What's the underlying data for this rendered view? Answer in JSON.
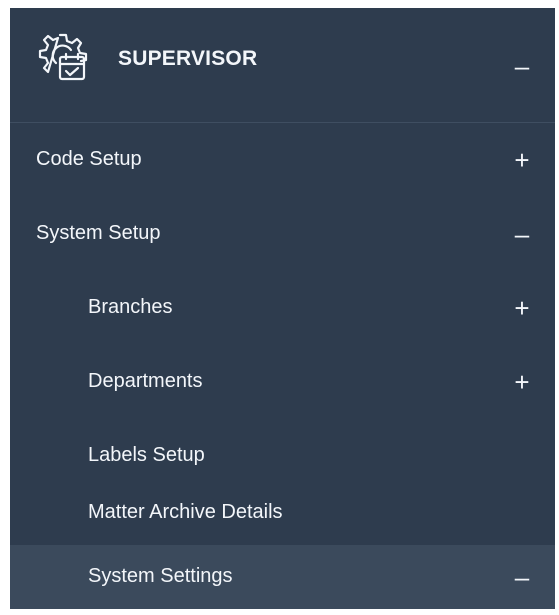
{
  "header": {
    "title": "SUPERVISOR",
    "icon": "gear-calendar-icon",
    "toggle": "–"
  },
  "menu": {
    "items": [
      {
        "label": "Code Setup",
        "toggle": "+"
      },
      {
        "label": "System Setup",
        "toggle": "–"
      },
      {
        "label": "Branches",
        "toggle": "+"
      },
      {
        "label": "Departments",
        "toggle": "+"
      },
      {
        "label": "Labels Setup"
      },
      {
        "label": "Matter Archive Details"
      },
      {
        "label": "System Settings",
        "toggle": "–"
      }
    ]
  },
  "colors": {
    "background": "#2e3c4e",
    "active_background": "#3b4a5c",
    "text": "#f3f6fa"
  }
}
